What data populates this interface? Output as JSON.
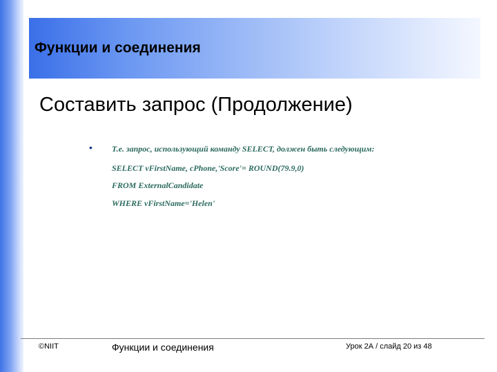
{
  "header": {
    "title": "Функции и соединения"
  },
  "slide": {
    "title": "Составить запрос (Продолжение)",
    "bullet_symbol": "•",
    "lines": [
      "Т.е. запрос, использующий команду SELECT, должен быть следующим:",
      "SELECT vFirstName, cPhone,'Score'= ROUND(79.9,0)",
      "FROM ExternalCandidate",
      "WHERE vFirstName='Helen'"
    ]
  },
  "footer": {
    "copyright": "©NIIT",
    "course": "Функции и соединения",
    "slide_info": "Урок 2А / слайд 20 из 48"
  }
}
